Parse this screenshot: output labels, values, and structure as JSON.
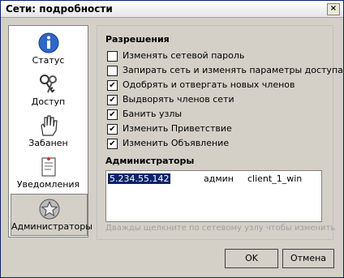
{
  "window": {
    "title": "Сети: подробности",
    "close_glyph": "×"
  },
  "sidebar": {
    "items": [
      {
        "label": "Статус",
        "icon": "info-icon"
      },
      {
        "label": "Доступ",
        "icon": "keys-icon"
      },
      {
        "label": "Забанен",
        "icon": "hand-icon"
      },
      {
        "label": "Уведомления",
        "icon": "notice-icon"
      },
      {
        "label": "Администраторы",
        "icon": "admin-star-icon",
        "active": true
      }
    ]
  },
  "permissions": {
    "title": "Разрешения",
    "items": [
      {
        "label": "Изменять сетевой пароль",
        "checked": false
      },
      {
        "label": "Запирать сеть и изменять параметры доступа",
        "checked": false
      },
      {
        "label": "Одобрять и отвергать новых членов",
        "checked": true
      },
      {
        "label": "Выдворять членов сети",
        "checked": true
      },
      {
        "label": "Банить узлы",
        "checked": true
      },
      {
        "label": "Изменить Приветствие",
        "checked": true
      },
      {
        "label": "Изменить Объявление",
        "checked": true
      }
    ]
  },
  "admins": {
    "title": "Администраторы",
    "rows": [
      {
        "ip": "5.234.55.142",
        "role": "админ",
        "client": "client_1_win"
      }
    ],
    "hint": "Дважды щелкните по сетевому узлу чтобы изменить"
  },
  "buttons": {
    "ok": "OK",
    "cancel": "Отмена"
  },
  "colors": {
    "selection": "#0a246a",
    "hint": "#a0a0a0"
  }
}
